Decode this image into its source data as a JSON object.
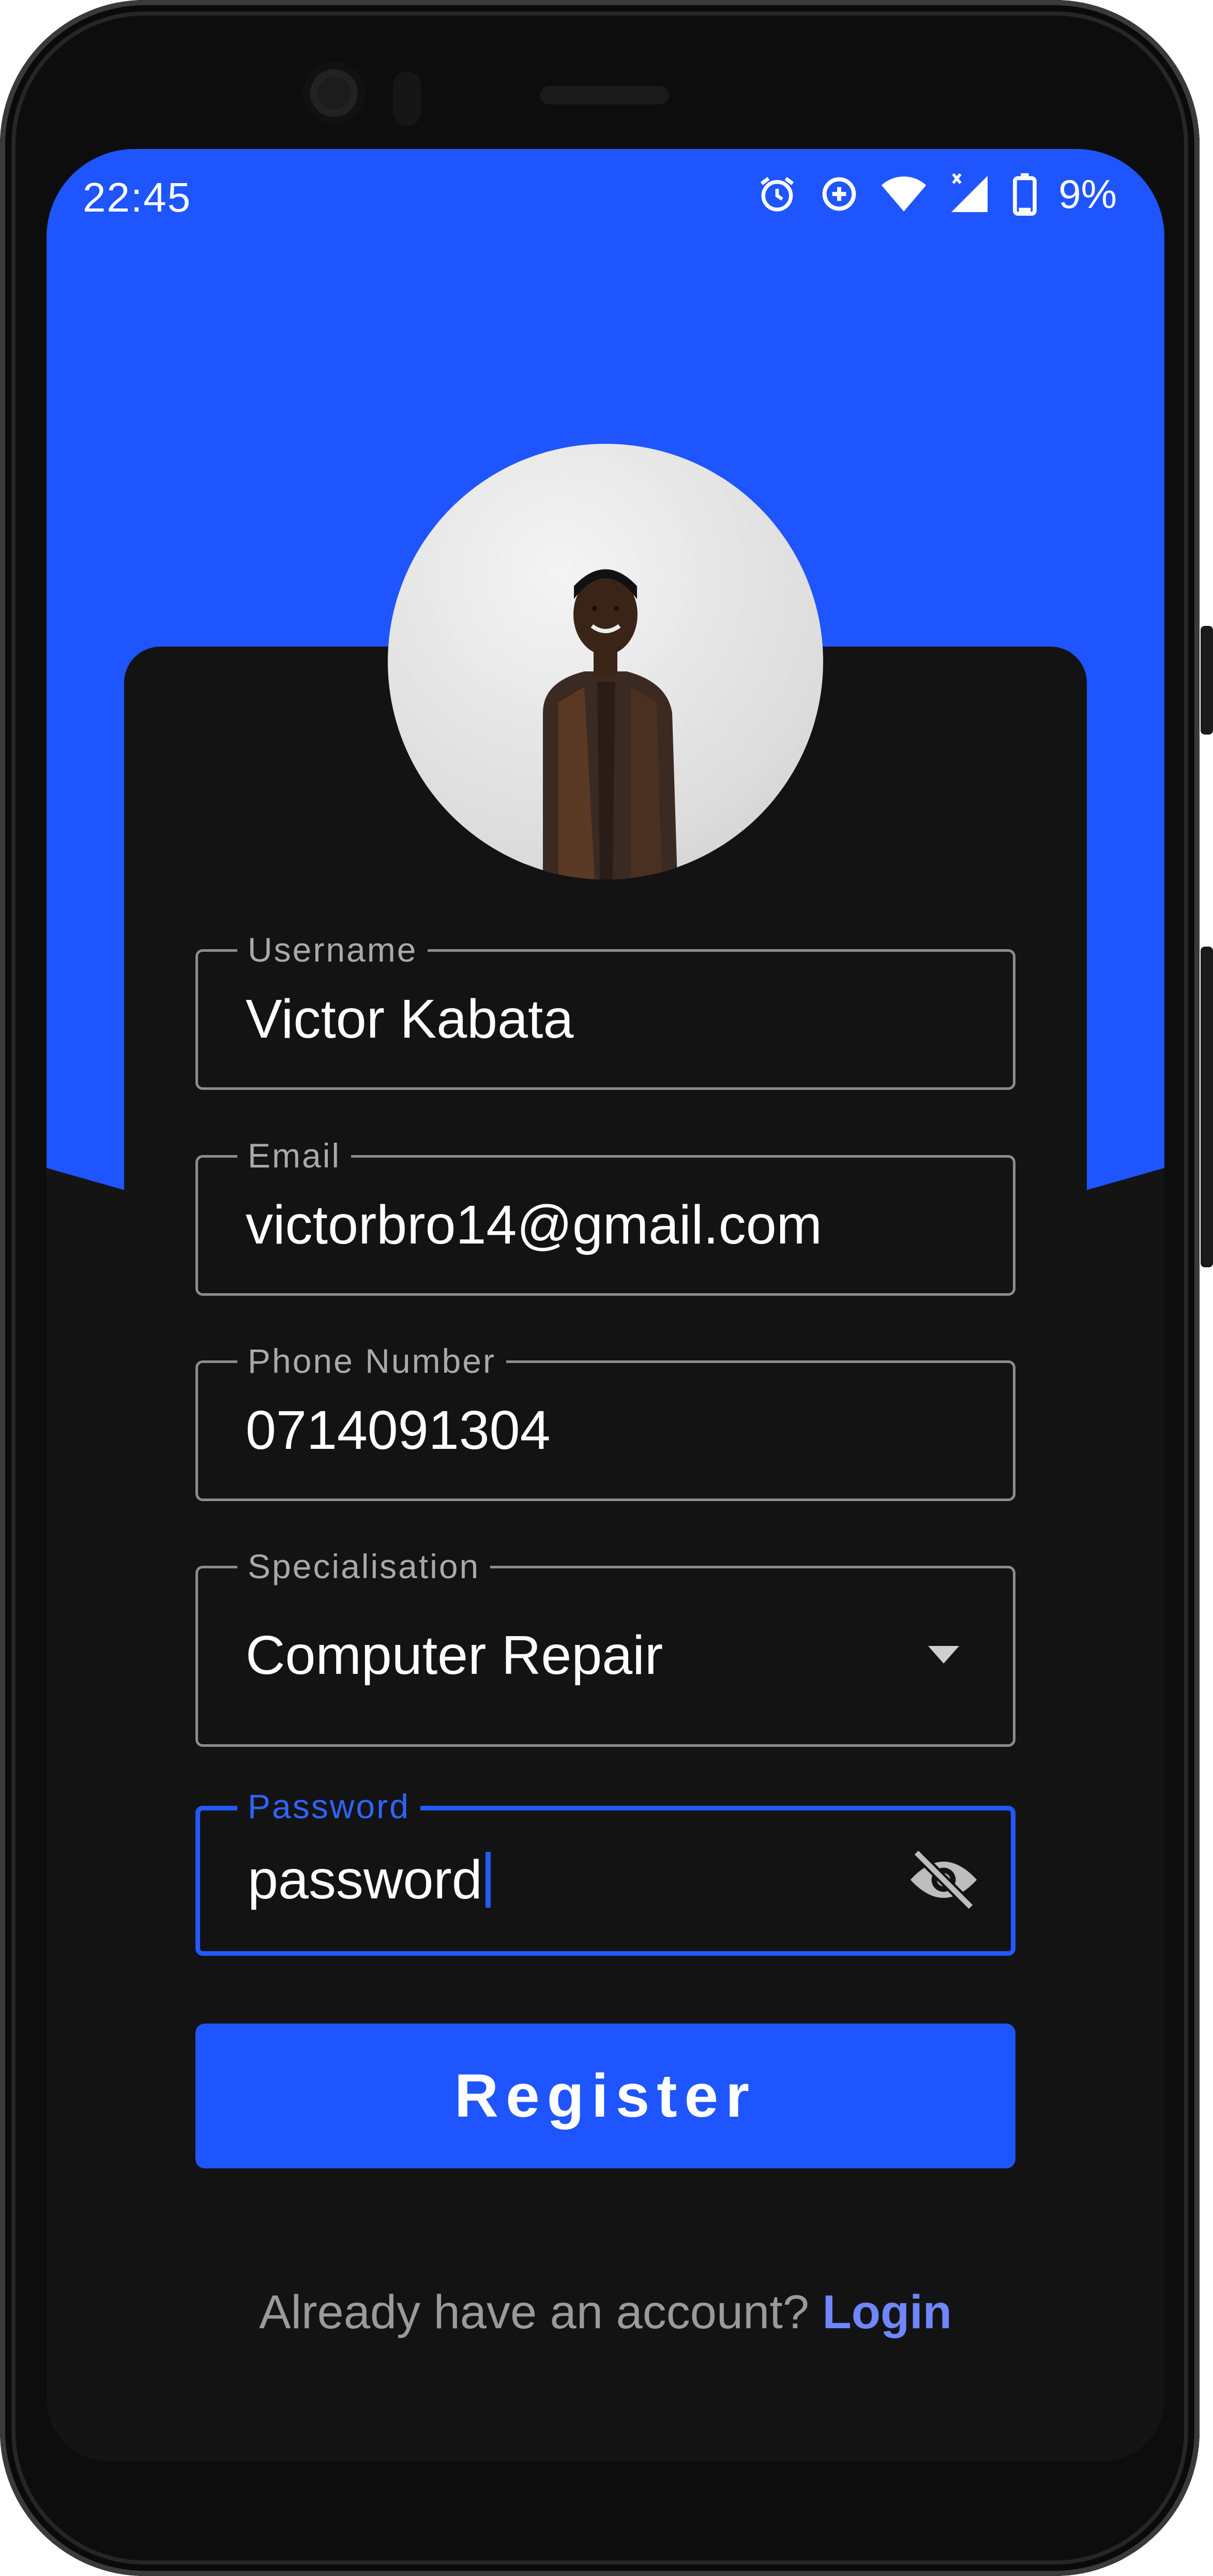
{
  "status_bar": {
    "time": "22:45",
    "icons": [
      "alarm-icon",
      "data-saver-icon",
      "wifi-icon",
      "signal-icon",
      "battery-icon"
    ],
    "battery": "9%",
    "signal_mark": "x"
  },
  "avatar": {
    "alt": "profile photo"
  },
  "form": {
    "username": {
      "label": "Username",
      "value": "Victor Kabata"
    },
    "email": {
      "label": "Email",
      "value": "victorbro14@gmail.com"
    },
    "phone": {
      "label": "Phone Number",
      "value": "0714091304"
    },
    "specialisation": {
      "label": "Specialisation",
      "value": "Computer Repair"
    },
    "password": {
      "label": "Password",
      "value": "password"
    }
  },
  "register_button": {
    "label": "Register"
  },
  "footer": {
    "prompt": "Already have an account?",
    "link": "Login"
  },
  "colors": {
    "accent": "#1e55ff",
    "background": "#141414",
    "link": "#6f86ff",
    "border": "#8c8c8c"
  }
}
